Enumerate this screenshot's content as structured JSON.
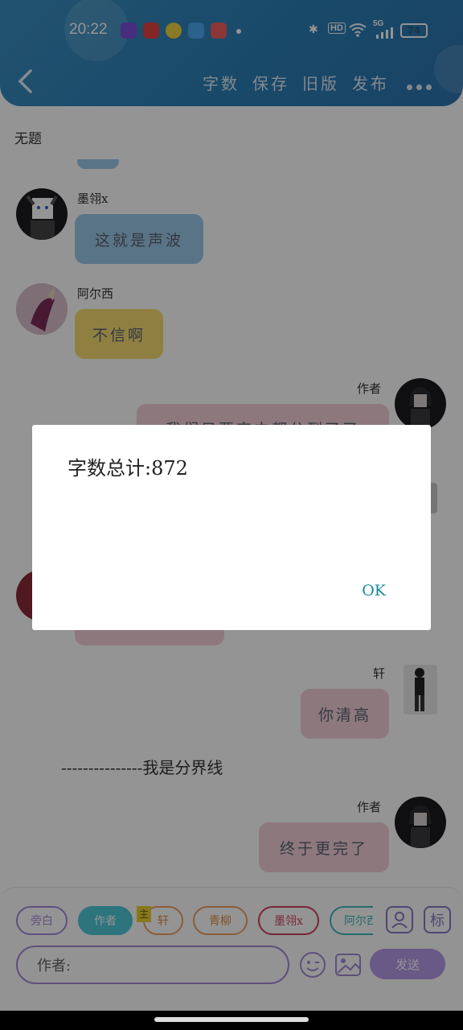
{
  "status_bar": {
    "time": "20:22",
    "battery": "74",
    "network": "5G",
    "hd": "HD"
  },
  "header": {
    "menu": [
      "字数",
      "保存",
      "旧版",
      "发布"
    ]
  },
  "document": {
    "title": "无题"
  },
  "messages": [
    {
      "name": "墨翎x",
      "text": "这就是声波",
      "color": "#9cc9e8"
    },
    {
      "name": "阿尔西",
      "text": "不信啊",
      "color": "#f6dc72"
    },
    {
      "name": "作者",
      "text": "我们只要空中都分到了了",
      "color": "#f2cfd7"
    },
    {
      "name": "轩",
      "text": "你清高",
      "color": "#f2cfd7"
    },
    {
      "name": "作者",
      "text": "终于更完了",
      "color": "#f2cfd7"
    }
  ],
  "divider": "---------------我是分界线",
  "composer": {
    "roles": [
      "旁白",
      "作者",
      "轩",
      "青柳",
      "墨翎x",
      "阿尔西"
    ],
    "active_role": "作者",
    "role_badge": "主",
    "input_value": "作者:",
    "send_label": "发送",
    "tool_icons": [
      "person-icon",
      "tag-icon"
    ],
    "tool_tag_label": "标"
  },
  "dialog": {
    "message": "字数总计:872",
    "ok_label": "OK"
  },
  "colors": {
    "accent": "#4ec8d8",
    "purple": "#a48ad8",
    "header": "#2b7fb6",
    "dialog_button": "#1a8a9c"
  }
}
